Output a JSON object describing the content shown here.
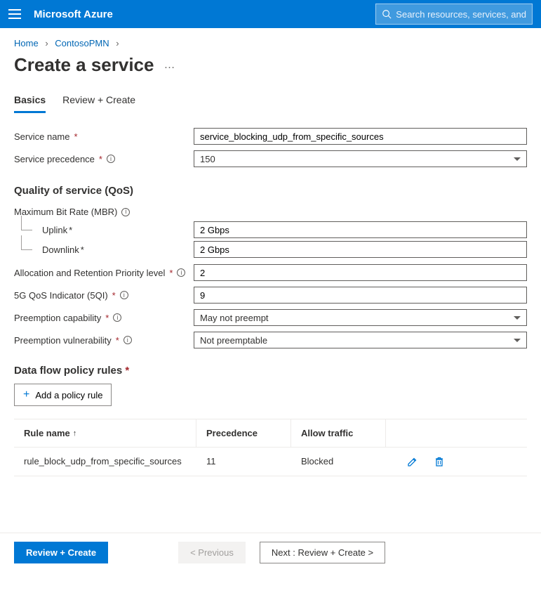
{
  "topbar": {
    "brand": "Microsoft Azure",
    "search_placeholder": "Search resources, services, and"
  },
  "breadcrumb": {
    "home": "Home",
    "resource": "ContosoPMN"
  },
  "page": {
    "title": "Create a service"
  },
  "tabs": {
    "basics": "Basics",
    "review": "Review + Create"
  },
  "form": {
    "service_name_label": "Service name",
    "service_name_value": "service_blocking_udp_from_specific_sources",
    "service_precedence_label": "Service precedence",
    "service_precedence_value": "150",
    "qos_section": "Quality of service (QoS)",
    "mbr_label": "Maximum Bit Rate (MBR)",
    "uplink_label": "Uplink",
    "uplink_value": "2 Gbps",
    "downlink_label": "Downlink",
    "downlink_value": "2 Gbps",
    "arp_label": "Allocation and Retention Priority level",
    "arp_value": "2",
    "fiveqi_label": "5G QoS Indicator (5QI)",
    "fiveqi_value": "9",
    "preempt_cap_label": "Preemption capability",
    "preempt_cap_value": "May not preempt",
    "preempt_vuln_label": "Preemption vulnerability",
    "preempt_vuln_value": "Not preemptable"
  },
  "dfp": {
    "section_title": "Data flow policy rules",
    "add_button": "Add a policy rule",
    "col_rule_name": "Rule name",
    "col_precedence": "Precedence",
    "col_allow": "Allow traffic",
    "row1": {
      "name": "rule_block_udp_from_specific_sources",
      "precedence": "11",
      "allow": "Blocked"
    }
  },
  "footer": {
    "review": "Review + Create",
    "previous": "< Previous",
    "next": "Next : Review + Create >"
  }
}
